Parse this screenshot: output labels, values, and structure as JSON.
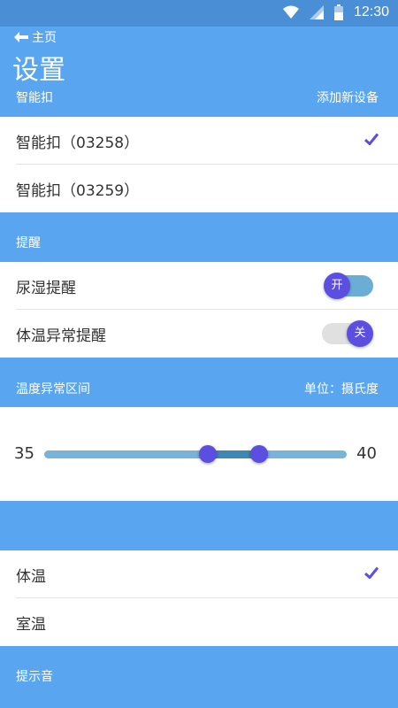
{
  "status_bar": {
    "time": "12:30",
    "icons": [
      "wifi-icon",
      "cell-signal-icon",
      "battery-icon"
    ]
  },
  "header": {
    "back_label": "主页",
    "title": "设置"
  },
  "devices": {
    "section_title": "智能扣",
    "add_label": "添加新设备",
    "items": [
      {
        "label": "智能扣（03258）",
        "selected": true
      },
      {
        "label": "智能扣（03259）",
        "selected": false
      }
    ]
  },
  "reminders": {
    "section_title": "提醒",
    "items": [
      {
        "label": "尿湿提醒",
        "state": "开",
        "on": true
      },
      {
        "label": "体温异常提醒",
        "state": "关",
        "on": false
      }
    ]
  },
  "temp_range": {
    "section_title": "温度异常区间",
    "unit_label": "单位：摄氏度",
    "min": "35",
    "max": "40",
    "low_fraction": 0.54,
    "high_fraction": 0.71
  },
  "temp_source": {
    "items": [
      {
        "label": "体温",
        "selected": true
      },
      {
        "label": "室温",
        "selected": false
      }
    ]
  },
  "sound": {
    "section_title": "提示音"
  },
  "colors": {
    "header": "#5aa5ef",
    "status_bar": "#4a8ed6",
    "accent": "#5b4ee0",
    "toggle_on": "#6aaed6",
    "toggle_off": "#e0e0e0"
  }
}
